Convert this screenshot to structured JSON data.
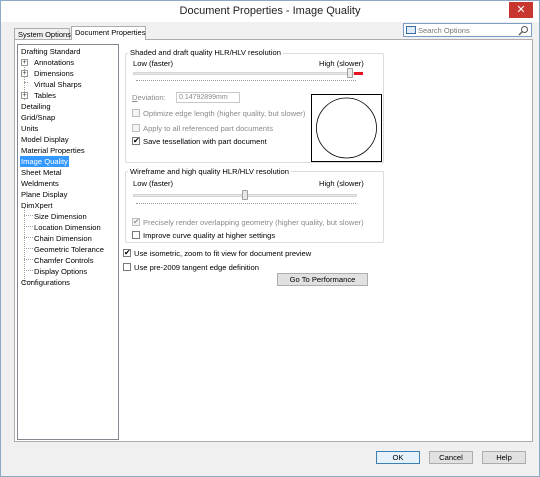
{
  "window": {
    "title": "Document Properties - Image Quality",
    "close_glyph": "✕"
  },
  "tabs": [
    {
      "label": "System Options",
      "active": false
    },
    {
      "label": "Document Properties",
      "active": true
    }
  ],
  "search": {
    "placeholder": "Search Options"
  },
  "tree": {
    "items": [
      {
        "label": "Drafting Standard",
        "level": 0
      },
      {
        "label": "Annotations",
        "level": 1,
        "expander": "+"
      },
      {
        "label": "Dimensions",
        "level": 1,
        "expander": "+"
      },
      {
        "label": "Virtual Sharps",
        "level": 1
      },
      {
        "label": "Tables",
        "level": 1,
        "expander": "+"
      },
      {
        "label": "Detailing",
        "level": 0
      },
      {
        "label": "Grid/Snap",
        "level": 0
      },
      {
        "label": "Units",
        "level": 0
      },
      {
        "label": "Model Display",
        "level": 0
      },
      {
        "label": "Material Properties",
        "level": 0
      },
      {
        "label": "Image Quality",
        "level": 0,
        "selected": true
      },
      {
        "label": "Sheet Metal",
        "level": 0
      },
      {
        "label": "Weldments",
        "level": 0
      },
      {
        "label": "Plane Display",
        "level": 0
      },
      {
        "label": "DimXpert",
        "level": 0
      },
      {
        "label": "Size Dimension",
        "level": 1
      },
      {
        "label": "Location Dimension",
        "level": 1
      },
      {
        "label": "Chain Dimension",
        "level": 1
      },
      {
        "label": "Geometric Tolerance",
        "level": 1
      },
      {
        "label": "Chamfer Controls",
        "level": 1
      },
      {
        "label": "Display Options",
        "level": 1
      },
      {
        "label": "Configurations",
        "level": 0
      }
    ]
  },
  "shaded": {
    "title": "Shaded and draft quality HLR/HLV resolution",
    "low_label": "Low (faster)",
    "high_label": "High (slower)",
    "slider_level": 0.97,
    "deviation_label": "Deviation:",
    "deviation_value": "0.14792899mm",
    "optimize_label": "Optimize edge length (higher quality, but slower)",
    "apply_label": "Apply to all referenced part documents",
    "save_label": "Save tessellation with part document",
    "optimize_checked": false,
    "apply_checked": false,
    "save_checked": true
  },
  "wireframe": {
    "title": "Wireframe and high quality HLR/HLV resolution",
    "low_label": "Low (faster)",
    "high_label": "High (slower)",
    "slider_level": 0.5,
    "precisely_label": "Precisely render overlapping geometry (higher quality, but slower)",
    "improve_label": "Improve curve quality at higher settings",
    "precisely_checked": true,
    "improve_checked": false
  },
  "options": {
    "isometric_label": "Use isometric, zoom to fit view for document preview",
    "pre2009_label": "Use pre-2009 tangent edge definition",
    "isometric_checked": true,
    "pre2009_checked": false
  },
  "buttons": {
    "performance": "Go To Performance",
    "ok": "OK",
    "cancel": "Cancel",
    "help": "Help"
  },
  "check_glyph": "✔"
}
